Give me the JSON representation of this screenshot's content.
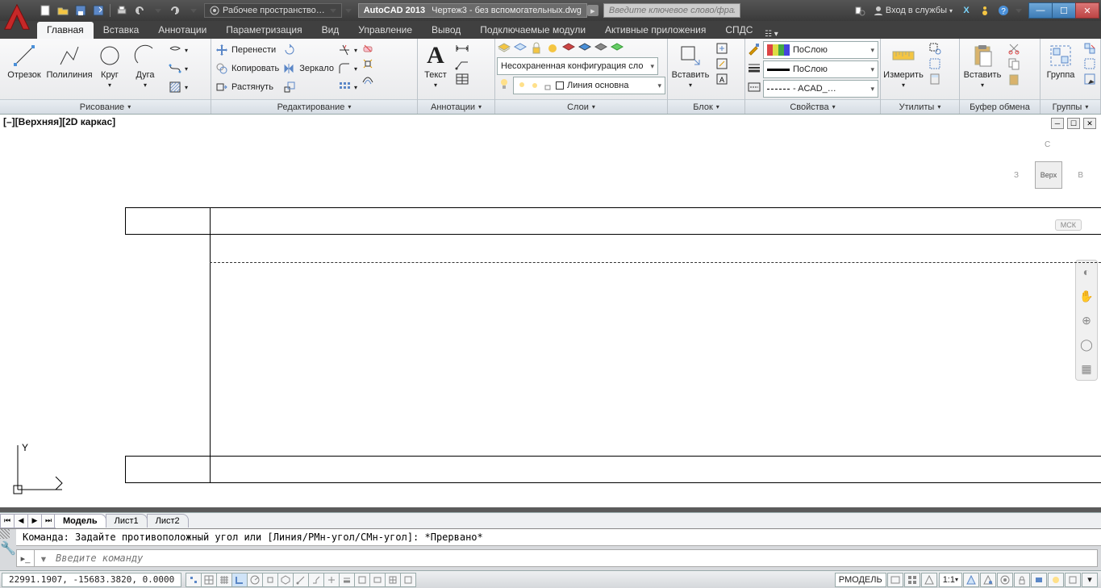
{
  "title": {
    "app": "AutoCAD 2013",
    "doc": "Чертеж3 - без вспомогательных.dwg",
    "workspace": "Рабочее пространство…",
    "search_placeholder": "Введите ключевое слово/фразу",
    "sign_in": "Вход в службы"
  },
  "tabs": {
    "items": [
      "Главная",
      "Вставка",
      "Аннотации",
      "Параметризация",
      "Вид",
      "Управление",
      "Вывод",
      "Подключаемые модули",
      "Активные приложения",
      "СПДС"
    ],
    "active": 0
  },
  "ribbon": {
    "draw": {
      "line": "Отрезок",
      "polyline": "Полилиния",
      "circle": "Круг",
      "arc": "Дуга",
      "panel": "Рисование"
    },
    "modify": {
      "move": "Перенести",
      "copy": "Копировать",
      "stretch": "Растянуть",
      "mirror": "Зеркало",
      "panel": "Редактирование"
    },
    "annot": {
      "text": "Текст",
      "panel": "Аннотации"
    },
    "layers": {
      "unsaved": "Несохраненная конфигурация сло",
      "current": "Линия основна",
      "panel": "Слои"
    },
    "block": {
      "insert": "Вставить",
      "panel": "Блок"
    },
    "props": {
      "bylayer": "ПоСлою",
      "bylayer2": "ПоСлою",
      "acad": "- ACAD_…",
      "panel": "Свойства"
    },
    "util": {
      "measure": "Измерить",
      "panel": "Утилиты"
    },
    "clip": {
      "paste": "Вставить",
      "panel": "Буфер обмена"
    },
    "group": {
      "group": "Группа",
      "panel": "Группы"
    }
  },
  "viewport": {
    "label": "[–][Верхняя][2D каркас]",
    "cube_top": "Верх",
    "cube_n": "С",
    "cube_w": "З",
    "cube_e": "В",
    "wcs": "МСК"
  },
  "layout": {
    "model": "Модель",
    "sheet1": "Лист1",
    "sheet2": "Лист2"
  },
  "cmd": {
    "history": "Команда: Задайте противоположный угол или [Линия/РМн-угол/СМн-угол]: *Прервано*",
    "placeholder": "Введите команду"
  },
  "status": {
    "coords": "22991.1907, -15683.3820, 0.0000",
    "space": "РМОДЕЛЬ",
    "scale": "1:1"
  }
}
